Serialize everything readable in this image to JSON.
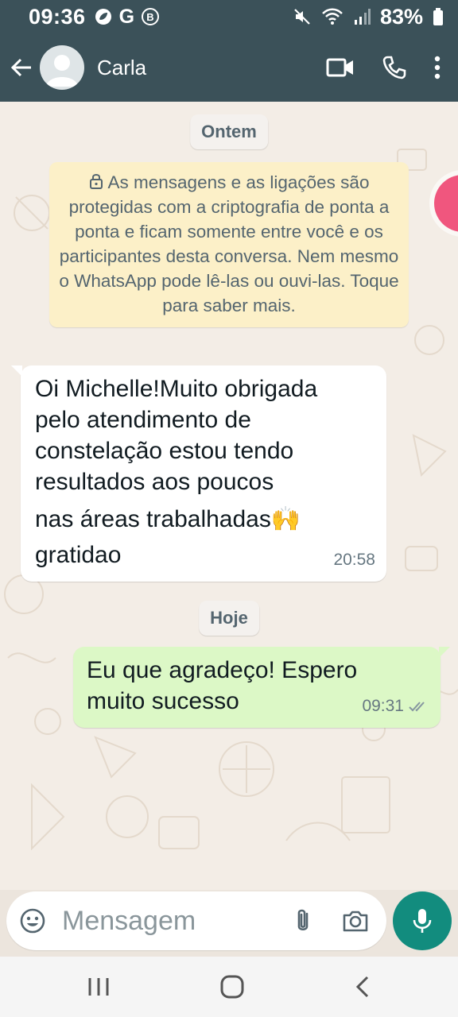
{
  "status_bar": {
    "time": "09:36",
    "left_icons": [
      "leaf-icon",
      "G",
      "bitcoin-icon"
    ],
    "battery": "83%"
  },
  "app_bar": {
    "contact_name": "Carla"
  },
  "chat": {
    "date_yesterday": "Ontem",
    "encryption_notice": "As mensagens e as ligações são protegidas com a criptografia de ponta a ponta e ficam somente entre você e os participantes desta conversa. Nem mesmo o WhatsApp pode lê-las ou ouvi-las. Toque para saber mais.",
    "incoming": {
      "lines": [
        "Oi Michelle!Muito obrigada",
        "pelo atendimento de",
        "constelação estou tendo",
        "resultados aos poucos",
        "nas áreas trabalhadas🙌",
        "gratidao"
      ],
      "time": "20:58"
    },
    "date_today": "Hoje",
    "outgoing": {
      "lines": [
        "Eu que agradeço! Espero",
        "muito sucesso"
      ],
      "time": "09:31"
    }
  },
  "composer": {
    "placeholder": "Mensagem"
  },
  "colors": {
    "header": "#3b5159",
    "outgoing_bubble": "#dcf8c6",
    "mic_button": "#128c7e",
    "notice": "#fcf0c8"
  }
}
